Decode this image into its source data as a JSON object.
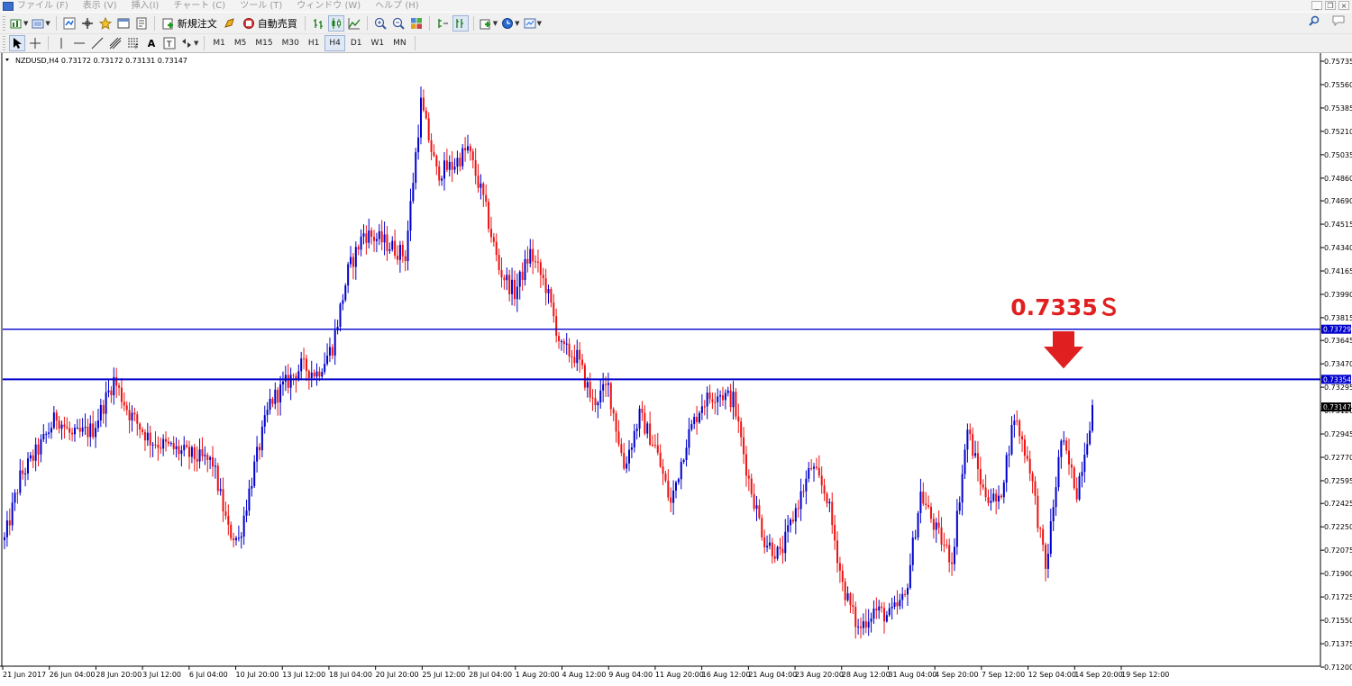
{
  "menu": {
    "items": [
      "ファイル (F)",
      "表示 (V)",
      "挿入(I)",
      "チャート (C)",
      "ツール (T)",
      "ウィンドウ (W)",
      "ヘルプ (H)"
    ]
  },
  "toolbar": {
    "new_order_label": "新規注文",
    "auto_trading_label": "自動売買",
    "timeframes": [
      "M1",
      "M5",
      "M15",
      "M30",
      "H1",
      "H4",
      "D1",
      "W1",
      "MN"
    ],
    "active_timeframe": "H4"
  },
  "chart_data": {
    "type": "candlestick",
    "symbol_header": "NZDUSD,H4  0.73172 0.73172 0.73131 0.73147",
    "colors": {
      "bull": "#0000cc",
      "bear": "#ee1111",
      "hline": "#0000cc",
      "annotation": "#e02020",
      "current_price_bg": "#000000"
    },
    "y_axis": {
      "ylim": [
        0.7112,
        0.7582
      ],
      "ticks": [
        0.75735,
        0.7556,
        0.75385,
        0.7521,
        0.75035,
        0.7486,
        0.7469,
        0.74515,
        0.7434,
        0.74165,
        0.7399,
        0.73815,
        0.73645,
        0.7347,
        0.73295,
        0.7312,
        0.72945,
        0.7277,
        0.72595,
        0.72425,
        0.7225,
        0.72075,
        0.719,
        0.71725,
        0.7155,
        0.71375,
        0.712
      ],
      "tick_labels": [
        "0.75735",
        "0.75560",
        "0.75385",
        "0.75210",
        "0.75035",
        "0.74860",
        "0.74690",
        "0.74515",
        "0.74340",
        "0.74165",
        "0.73990",
        "0.73815",
        "0.73645",
        "0.73470",
        "0.73295",
        "0.73120",
        "0.72945",
        "0.72770",
        "0.72595",
        "0.72425",
        "0.72250",
        "0.72075",
        "0.71900",
        "0.71725",
        "0.71550",
        "0.71375",
        "0.71200"
      ]
    },
    "x_axis": {
      "tick_labels": [
        "21 Jun 2017",
        "26 Jun 04:00",
        "28 Jun 20:00",
        "3 Jul 12:00",
        "6 Jul 04:00",
        "10 Jul 20:00",
        "13 Jul 12:00",
        "18 Jul 04:00",
        "20 Jul 20:00",
        "25 Jul 12:00",
        "28 Jul 04:00",
        "1 Aug 20:00",
        "4 Aug 12:00",
        "9 Aug 04:00",
        "11 Aug 20:00",
        "16 Aug 12:00",
        "21 Aug 04:00",
        "23 Aug 20:00",
        "28 Aug 12:00",
        "31 Aug 04:00",
        "4 Sep 20:00",
        "7 Sep 12:00",
        "12 Sep 04:00",
        "14 Sep 20:00",
        "19 Sep 12:00"
      ]
    },
    "horizontal_lines": [
      {
        "price": 0.73729,
        "label": "0.73729"
      },
      {
        "price": 0.73354,
        "label": "0.73354"
      }
    ],
    "current_price": {
      "price": 0.73147,
      "label": "0.73147"
    },
    "annotation": {
      "text": "0.7335Ｓ",
      "arrow": "down",
      "target_price": 0.73354
    },
    "anchors": [
      {
        "bar": 0,
        "price": 0.7215
      },
      {
        "bar": 6,
        "price": 0.7262
      },
      {
        "bar": 14,
        "price": 0.7286
      },
      {
        "bar": 20,
        "price": 0.7308
      },
      {
        "bar": 26,
        "price": 0.7292
      },
      {
        "bar": 34,
        "price": 0.7298
      },
      {
        "bar": 42,
        "price": 0.7335
      },
      {
        "bar": 48,
        "price": 0.731
      },
      {
        "bar": 56,
        "price": 0.729
      },
      {
        "bar": 64,
        "price": 0.7284
      },
      {
        "bar": 72,
        "price": 0.7278
      },
      {
        "bar": 80,
        "price": 0.7273
      },
      {
        "bar": 86,
        "price": 0.7222
      },
      {
        "bar": 90,
        "price": 0.7215
      },
      {
        "bar": 96,
        "price": 0.727
      },
      {
        "bar": 102,
        "price": 0.7318
      },
      {
        "bar": 108,
        "price": 0.7332
      },
      {
        "bar": 114,
        "price": 0.7345
      },
      {
        "bar": 120,
        "price": 0.734
      },
      {
        "bar": 126,
        "price": 0.736
      },
      {
        "bar": 132,
        "price": 0.7416
      },
      {
        "bar": 138,
        "price": 0.7445
      },
      {
        "bar": 146,
        "price": 0.7438
      },
      {
        "bar": 154,
        "price": 0.7428
      },
      {
        "bar": 160,
        "price": 0.7542
      },
      {
        "bar": 166,
        "price": 0.749
      },
      {
        "bar": 172,
        "price": 0.7495
      },
      {
        "bar": 178,
        "price": 0.7508
      },
      {
        "bar": 184,
        "price": 0.747
      },
      {
        "bar": 190,
        "price": 0.7418
      },
      {
        "bar": 196,
        "price": 0.74
      },
      {
        "bar": 202,
        "price": 0.743
      },
      {
        "bar": 208,
        "price": 0.7405
      },
      {
        "bar": 214,
        "price": 0.7358
      },
      {
        "bar": 220,
        "price": 0.7352
      },
      {
        "bar": 226,
        "price": 0.7318
      },
      {
        "bar": 232,
        "price": 0.733
      },
      {
        "bar": 238,
        "price": 0.727
      },
      {
        "bar": 244,
        "price": 0.7308
      },
      {
        "bar": 250,
        "price": 0.7285
      },
      {
        "bar": 256,
        "price": 0.7242
      },
      {
        "bar": 262,
        "price": 0.729
      },
      {
        "bar": 268,
        "price": 0.7318
      },
      {
        "bar": 274,
        "price": 0.7326
      },
      {
        "bar": 280,
        "price": 0.732
      },
      {
        "bar": 286,
        "price": 0.726
      },
      {
        "bar": 292,
        "price": 0.7215
      },
      {
        "bar": 298,
        "price": 0.7203
      },
      {
        "bar": 304,
        "price": 0.7238
      },
      {
        "bar": 310,
        "price": 0.727
      },
      {
        "bar": 316,
        "price": 0.7248
      },
      {
        "bar": 322,
        "price": 0.7182
      },
      {
        "bar": 328,
        "price": 0.7148
      },
      {
        "bar": 334,
        "price": 0.7163
      },
      {
        "bar": 340,
        "price": 0.7158
      },
      {
        "bar": 346,
        "price": 0.7172
      },
      {
        "bar": 352,
        "price": 0.725
      },
      {
        "bar": 358,
        "price": 0.7222
      },
      {
        "bar": 364,
        "price": 0.72
      },
      {
        "bar": 370,
        "price": 0.7298
      },
      {
        "bar": 376,
        "price": 0.7252
      },
      {
        "bar": 382,
        "price": 0.7242
      },
      {
        "bar": 388,
        "price": 0.7308
      },
      {
        "bar": 394,
        "price": 0.727
      },
      {
        "bar": 400,
        "price": 0.7192
      },
      {
        "bar": 406,
        "price": 0.729
      },
      {
        "bar": 412,
        "price": 0.7252
      },
      {
        "bar": 418,
        "price": 0.7314
      }
    ]
  }
}
